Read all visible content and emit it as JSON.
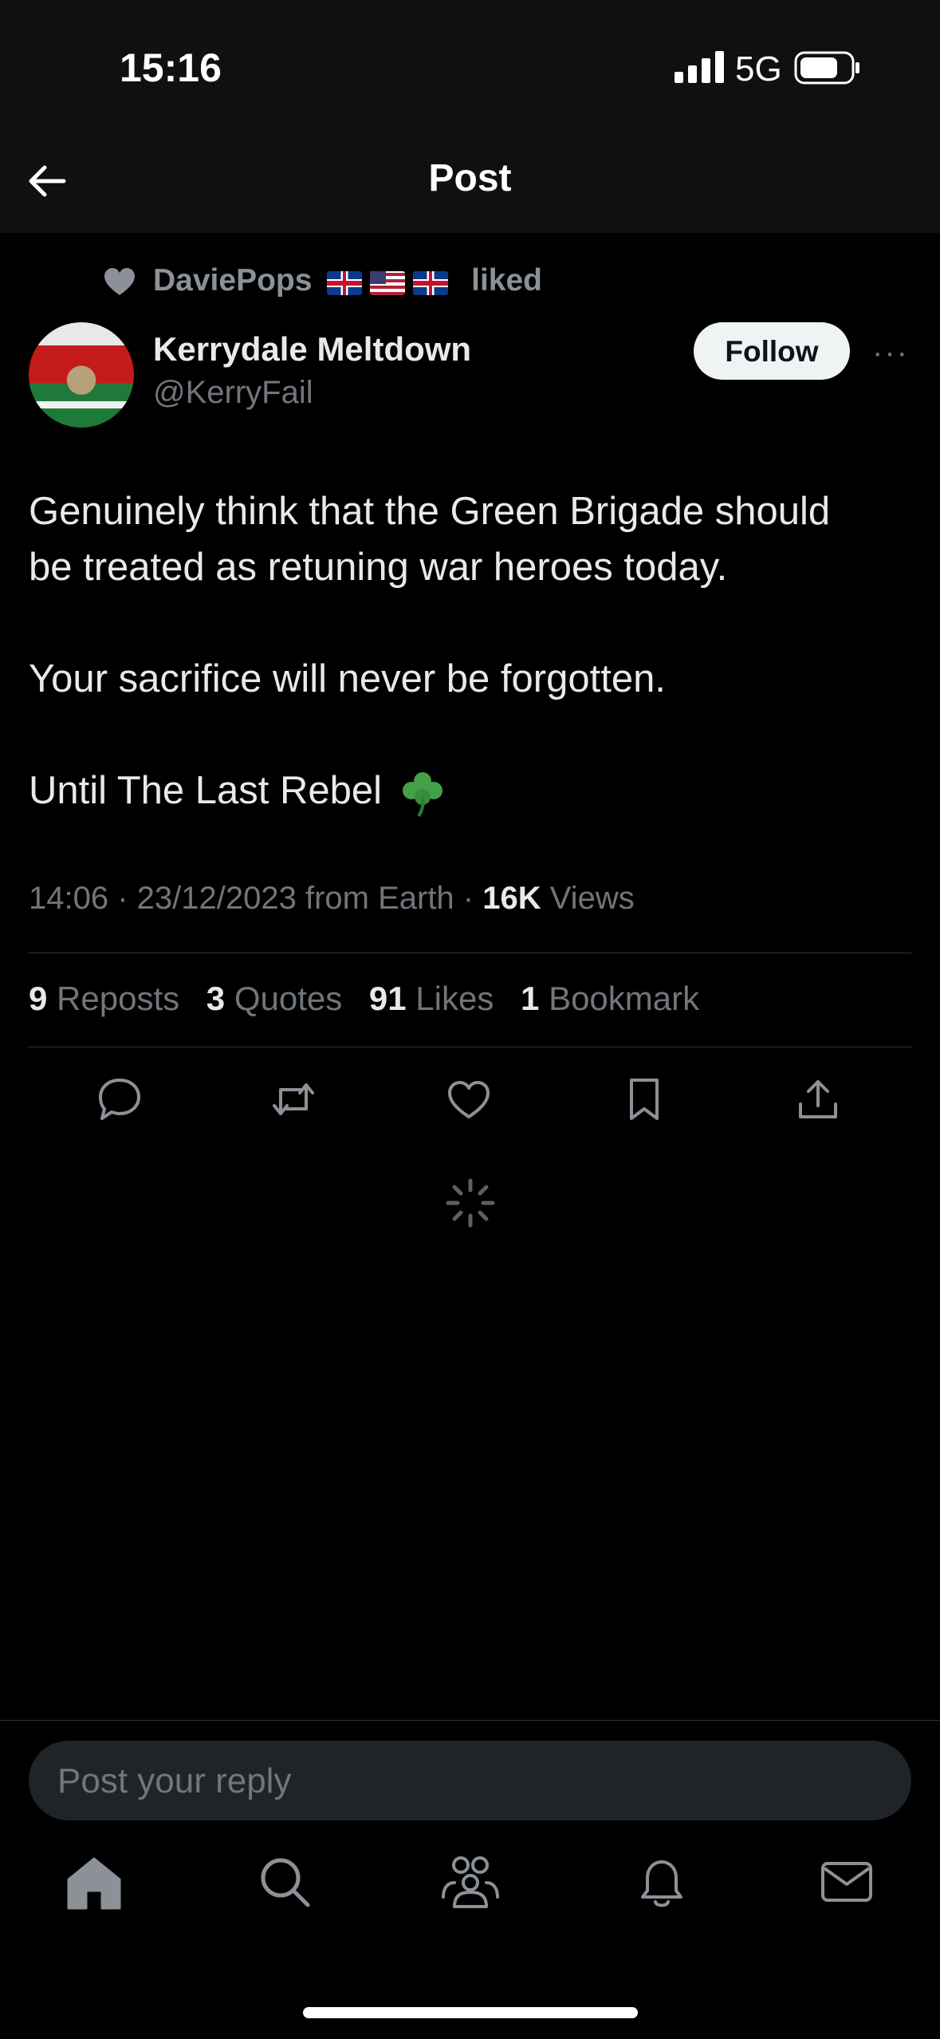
{
  "status_bar": {
    "time": "15:16",
    "network": "5G"
  },
  "header": {
    "title": "Post"
  },
  "social_context": {
    "liker": "DaviePops",
    "flags": [
      "uk-flag",
      "us-flag",
      "uk-flag"
    ],
    "suffix": "liked"
  },
  "author": {
    "name": "Kerrydale Meltdown",
    "handle": "@KerryFail",
    "follow_label": "Follow",
    "more_label": "···"
  },
  "post": {
    "line1": "Genuinely think that the Green Brigade should",
    "line2": "be treated as retuning war heroes today.",
    "line3": "Your sacrifice will never be forgotten.",
    "line4": "Until The Last Rebel"
  },
  "meta": {
    "timestamp": "14:06 · 23/12/2023 from Earth · ",
    "views_count": "16K",
    "views_label": " Views"
  },
  "stats": [
    {
      "count": "9",
      "label": "Reposts"
    },
    {
      "count": "3",
      "label": "Quotes"
    },
    {
      "count": "91",
      "label": "Likes"
    },
    {
      "count": "1",
      "label": "Bookmark"
    }
  ],
  "actions": [
    "reply-icon",
    "repost-icon",
    "like-icon",
    "bookmark-icon",
    "share-icon"
  ],
  "reply": {
    "placeholder": "Post your reply"
  },
  "bottom_nav": [
    "home-icon",
    "search-icon",
    "communities-icon",
    "notifications-icon",
    "messages-icon"
  ],
  "colors": {
    "background": "#000000",
    "header": "#101010",
    "text": "#e7e9ea",
    "muted": "#71767b",
    "divider": "#2f3336"
  }
}
